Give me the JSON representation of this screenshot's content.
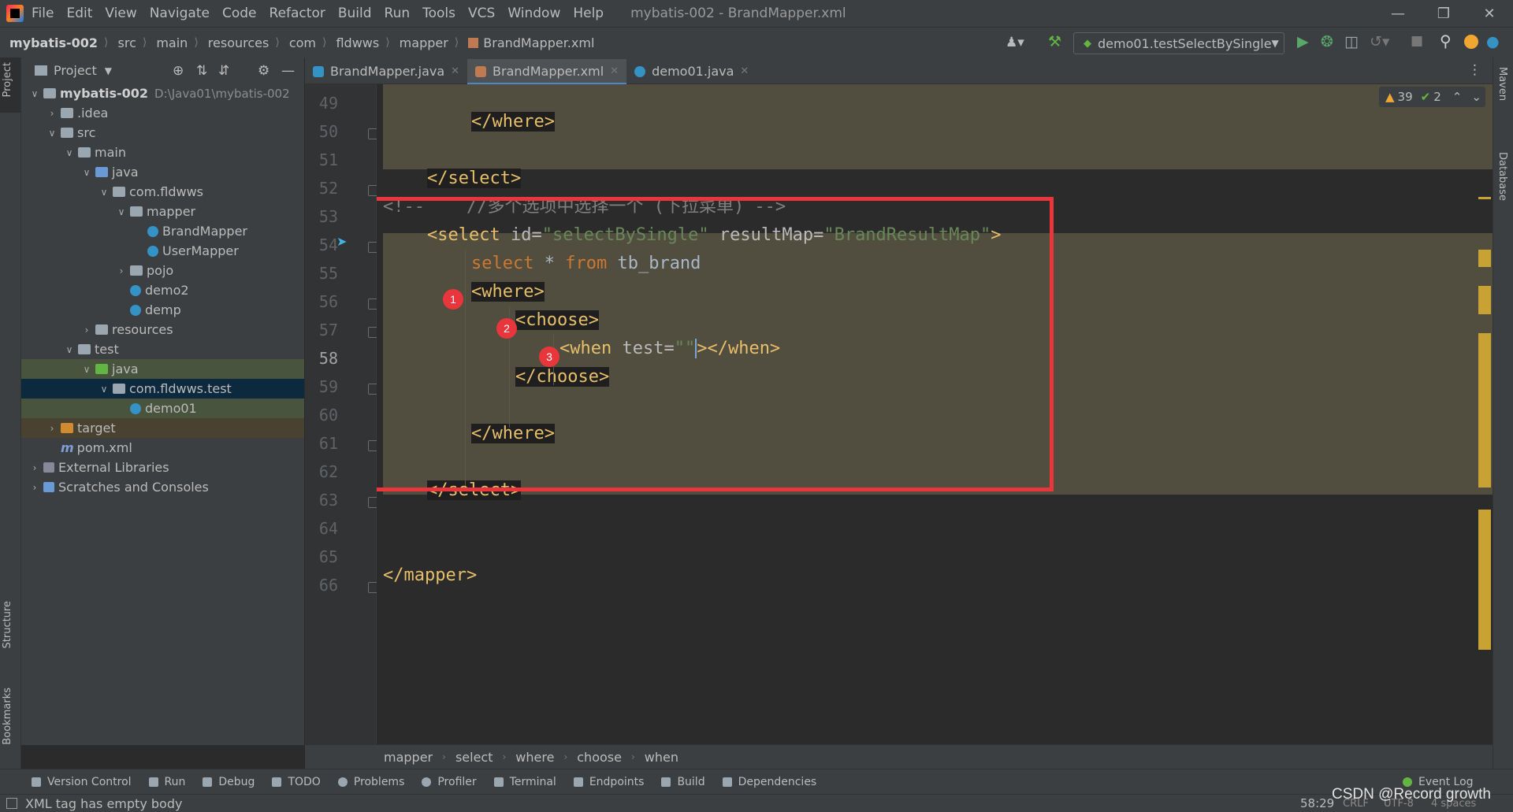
{
  "app": {
    "window_title": "mybatis-002 - BrandMapper.xml",
    "menu": [
      "File",
      "Edit",
      "View",
      "Navigate",
      "Code",
      "Refactor",
      "Build",
      "Run",
      "Tools",
      "VCS",
      "Window",
      "Help"
    ]
  },
  "navbar": {
    "breadcrumbs": [
      "mybatis-002",
      "src",
      "main",
      "resources",
      "com",
      "fldwws",
      "mapper",
      "BrandMapper.xml"
    ],
    "run_config": "demo01.testSelectBySingle"
  },
  "left_tools": [
    "Project",
    "Structure",
    "Bookmarks"
  ],
  "right_tools": [
    "Maven",
    "Database"
  ],
  "project_panel": {
    "title": "Project",
    "tree": [
      {
        "label": "mybatis-002",
        "path": "D:\\Java01\\mybatis-002"
      },
      {
        "label": ".idea"
      },
      {
        "label": "src"
      },
      {
        "label": "main"
      },
      {
        "label": "java"
      },
      {
        "label": "com.fldwws"
      },
      {
        "label": "mapper"
      },
      {
        "label": "BrandMapper"
      },
      {
        "label": "UserMapper"
      },
      {
        "label": "pojo"
      },
      {
        "label": "demo2"
      },
      {
        "label": "demp"
      },
      {
        "label": "resources"
      },
      {
        "label": "test"
      },
      {
        "label": "java"
      },
      {
        "label": "com.fldwws.test"
      },
      {
        "label": "demo01"
      },
      {
        "label": "target"
      },
      {
        "label": "pom.xml"
      },
      {
        "label": "External Libraries"
      },
      {
        "label": "Scratches and Consoles"
      }
    ]
  },
  "editor_tabs": [
    "BrandMapper.java",
    "BrandMapper.xml",
    "demo01.java"
  ],
  "warnings": {
    "warnings": "39",
    "weak": "2"
  },
  "editor": {
    "line_numbers": [
      "49",
      "50",
      "51",
      "52",
      "53",
      "54",
      "55",
      "56",
      "57",
      "58",
      "59",
      "60",
      "61",
      "62",
      "63",
      "64",
      "65",
      "66"
    ],
    "code": {
      "l50": "</where>",
      "l52": "</select>",
      "l53_open": "<!--",
      "l53_comment": "    //多个选项中选择一个 (下拉菜单) -->",
      "l54_tag": "<select",
      "l54_attr1": " id=",
      "l54_val1": "\"selectBySingle\"",
      "l54_attr2": " resultMap=",
      "l54_val2": "\"BrandResultMap\"",
      "l54_end": ">",
      "l55_kw1": "select",
      "l55_star": " * ",
      "l55_kw2": "from",
      "l55_tbl": " tb_brand",
      "l56": "<where>",
      "l57": "<choose>",
      "l58_tag": "<when",
      "l58_attr": " test=",
      "l58_val": "\"\"",
      "l58_end": "></when>",
      "l59": "</choose>",
      "l61": "</where>",
      "l63": "</select>",
      "l66": "</mapper>"
    },
    "badges": [
      "1",
      "2",
      "3"
    ]
  },
  "code_breadcrumbs": [
    "mapper",
    "select",
    "where",
    "choose",
    "when"
  ],
  "bottom_tools": [
    "Version Control",
    "Run",
    "Debug",
    "TODO",
    "Problems",
    "Profiler",
    "Terminal",
    "Endpoints",
    "Build",
    "Dependencies"
  ],
  "event_log": "Event Log",
  "status": {
    "message": "XML tag has empty body",
    "position": "58:29",
    "line_sep": "CRLF",
    "encoding": "UTF-8",
    "indent": "4 spaces"
  },
  "watermark": "CSDN @Record growth",
  "colors": {
    "highlight_box": "#e8363c",
    "tag": "#e8bf6a",
    "string": "#6a8759",
    "keyword": "#cc7832"
  }
}
